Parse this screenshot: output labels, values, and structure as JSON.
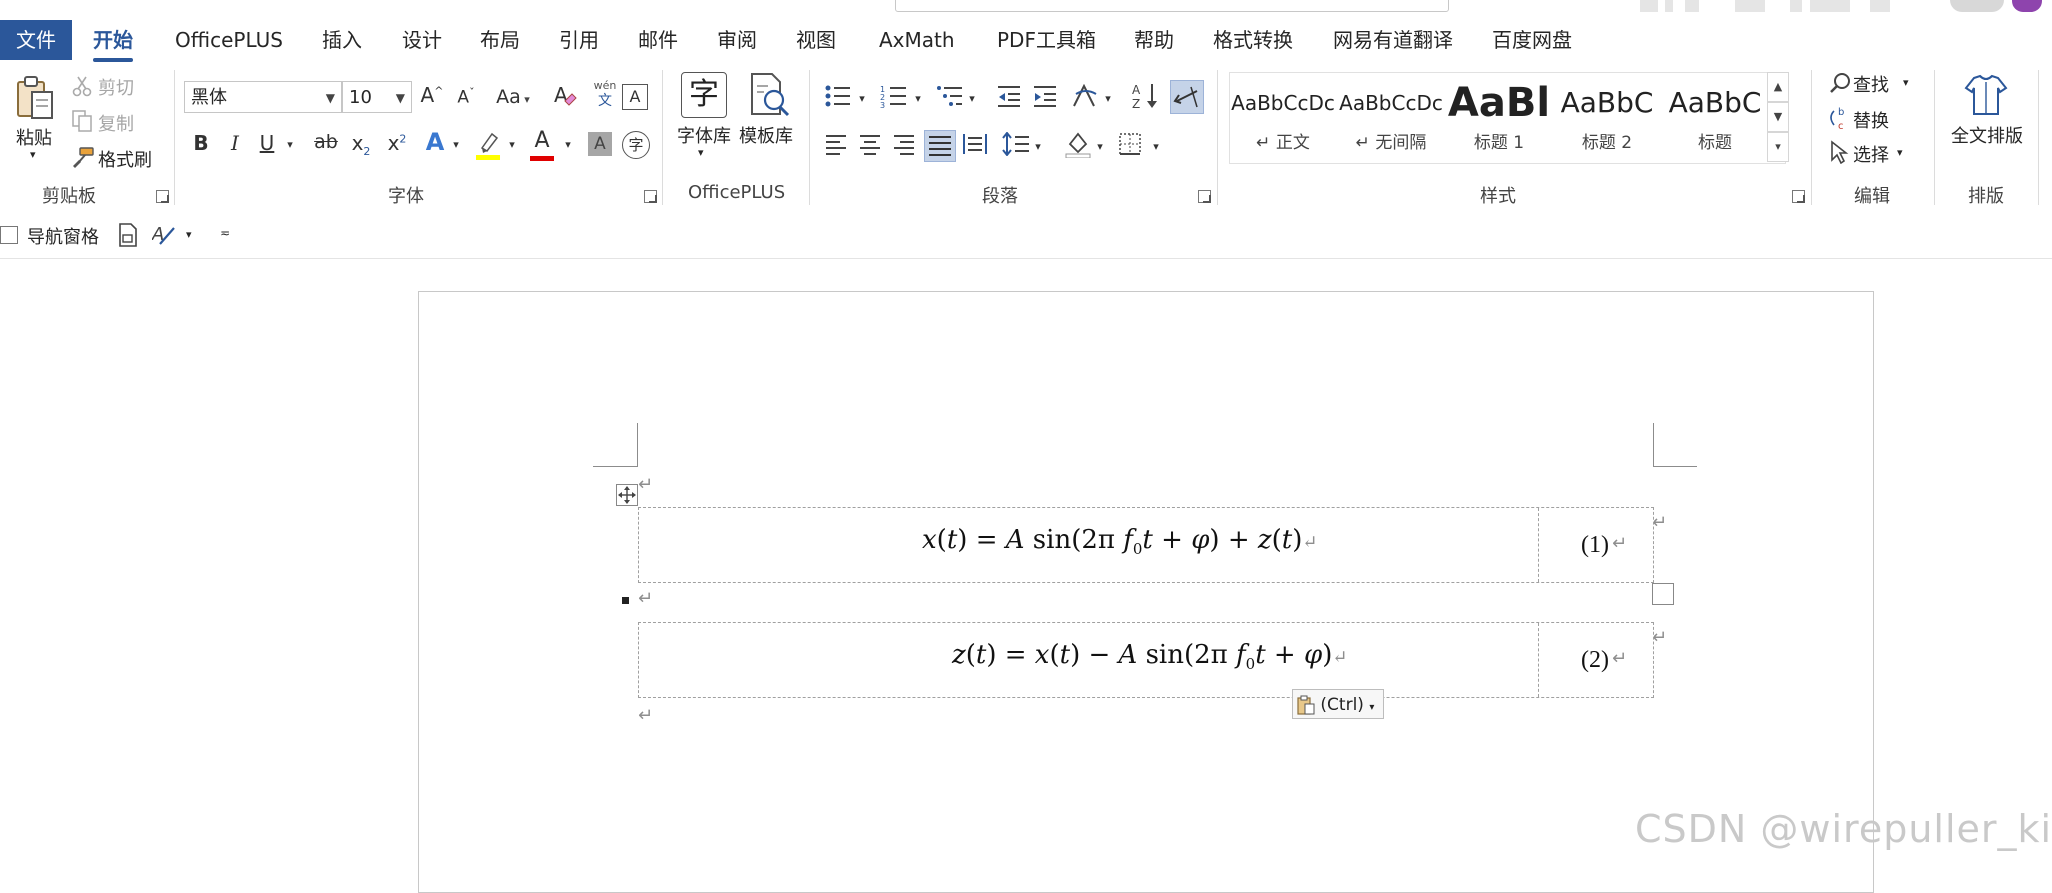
{
  "tabs": [
    {
      "label": "文件"
    },
    {
      "label": "开始"
    },
    {
      "label": "OfficePLUS"
    },
    {
      "label": "插入"
    },
    {
      "label": "设计"
    },
    {
      "label": "布局"
    },
    {
      "label": "引用"
    },
    {
      "label": "邮件"
    },
    {
      "label": "审阅"
    },
    {
      "label": "视图"
    },
    {
      "label": "AxMath"
    },
    {
      "label": "PDF工具箱"
    },
    {
      "label": "帮助"
    },
    {
      "label": "格式转换"
    },
    {
      "label": "网易有道翻译"
    },
    {
      "label": "百度网盘"
    }
  ],
  "clipboard": {
    "paste": "粘贴",
    "cut": "剪切",
    "copy": "复制",
    "format_painter": "格式刷",
    "group": "剪贴板"
  },
  "font": {
    "name": "黑体",
    "size": "10",
    "group": "字体",
    "change_case": "Aa",
    "phonetic_top": "wén",
    "phonetic_bottom": "文",
    "bold": "B",
    "italic": "I",
    "underline": "U",
    "strikethrough": "ab",
    "subscript": "x",
    "subscript_mark": "2",
    "superscript": "x",
    "superscript_mark": "2",
    "grow": "A",
    "shrink": "A",
    "text_effect": "A",
    "font_color": "A",
    "char_shading": "A",
    "enclose": "字",
    "char_border": "A",
    "highlight_color": "#ffff00",
    "font_color_value": "#e00000"
  },
  "officeplus": {
    "font_lib_icon_char": "字",
    "font_lib": "字体库",
    "template_lib": "模板库",
    "group": "OfficePLUS"
  },
  "paragraph": {
    "group": "段落"
  },
  "styles": {
    "group": "样式",
    "items": [
      {
        "sample": "AaBbCcDc",
        "name": "↵ 正文"
      },
      {
        "sample": "AaBbCcDc",
        "name": "↵ 无间隔"
      },
      {
        "sample": "AaBl",
        "name": "标题 1"
      },
      {
        "sample": "AaBbC",
        "name": "标题 2"
      },
      {
        "sample": "AaBbC",
        "name": "标题"
      }
    ]
  },
  "editing": {
    "find": "查找",
    "replace": "替换",
    "select": "选择",
    "group": "编辑"
  },
  "layout": {
    "full_layout": "全文排版",
    "group": "排版"
  },
  "navbar": {
    "nav_pane": "导航窗格"
  },
  "document": {
    "equations": [
      {
        "number": "(1)"
      },
      {
        "number": "(2)"
      }
    ],
    "paragraph_mark": "↵",
    "paste_options": "(Ctrl)"
  },
  "watermark": "CSDN @wirepuller_king",
  "colors": {
    "accent": "#2b579a",
    "selected_button": "#c5d3e8"
  }
}
